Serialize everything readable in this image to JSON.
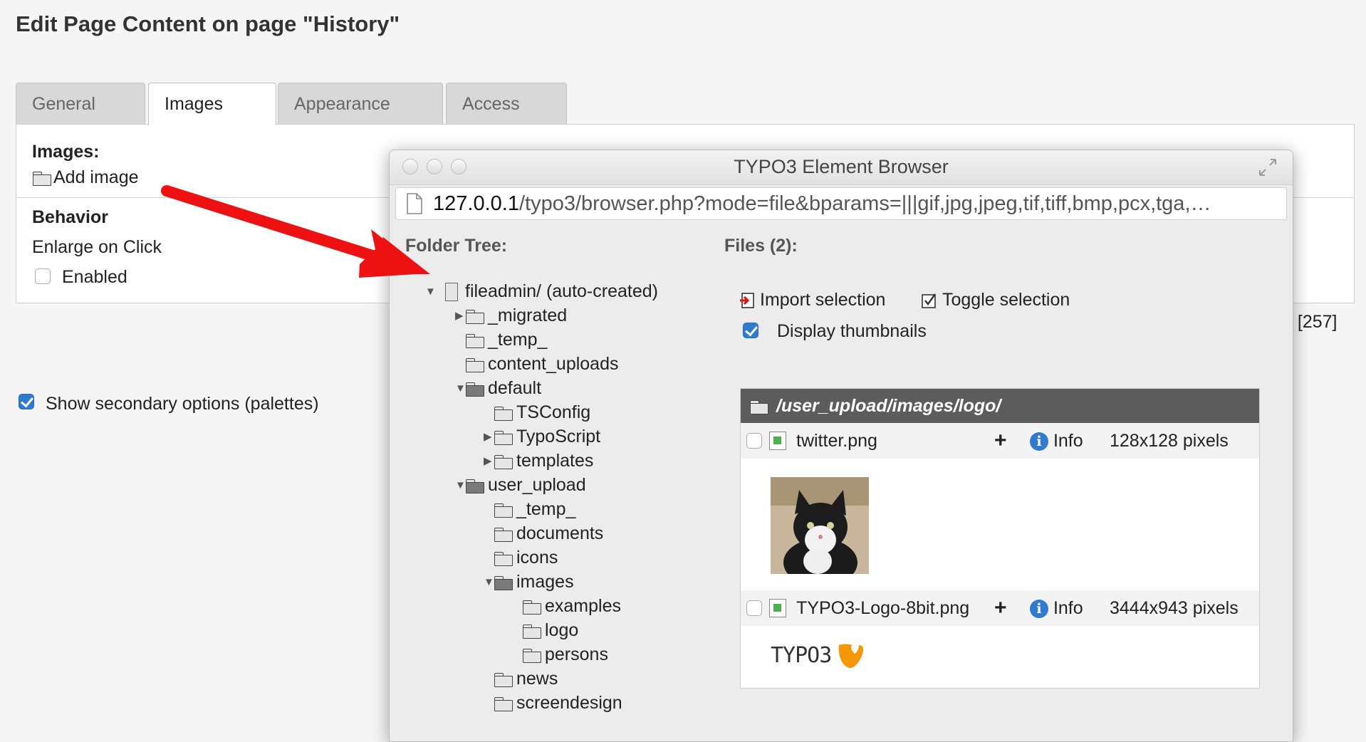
{
  "page": {
    "title": "Edit Page Content on page \"History\"",
    "tabs": [
      {
        "label": "General"
      },
      {
        "label": "Images"
      },
      {
        "label": "Appearance"
      },
      {
        "label": "Access"
      }
    ],
    "images_section": {
      "title": "Images:",
      "add_image": "Add image"
    },
    "behavior_section": {
      "title": "Behavior",
      "enlarge_label": "Enlarge on Click",
      "enabled_label": "Enabled"
    },
    "side_text": "t [257]",
    "secondary_options": "Show secondary options (palettes)"
  },
  "popup": {
    "window_title": "TYPO3 Element Browser",
    "url_host": "127.0.0.1",
    "url_path": "/typo3/browser.php?mode=file&bparams=|||gif,jpg,jpeg,tif,tiff,bmp,pcx,tga,…",
    "folder_tree_title": "Folder Tree:",
    "files_title": "Files (2):",
    "import_selection": "Import selection",
    "toggle_selection": "Toggle selection",
    "display_thumbnails": "Display thumbnails",
    "tree": [
      {
        "label": "fileadmin/ (auto-created)"
      },
      {
        "label": "_migrated"
      },
      {
        "label": "_temp_"
      },
      {
        "label": "content_uploads"
      },
      {
        "label": "default"
      },
      {
        "label": "TSConfig"
      },
      {
        "label": "TypoScript"
      },
      {
        "label": "templates"
      },
      {
        "label": "user_upload"
      },
      {
        "label": "_temp_"
      },
      {
        "label": "documents"
      },
      {
        "label": "icons"
      },
      {
        "label": "images"
      },
      {
        "label": "examples"
      },
      {
        "label": "logo"
      },
      {
        "label": "persons"
      },
      {
        "label": "news"
      },
      {
        "label": "screendesign"
      }
    ],
    "file_list": {
      "path": "/user_upload/images/logo/",
      "files": [
        {
          "name": "twitter.png",
          "add": "+",
          "info": "Info",
          "size": "128x128 pixels"
        },
        {
          "name": "TYPO3-Logo-8bit.png",
          "add": "+",
          "info": "Info",
          "size": "3444x943 pixels"
        }
      ],
      "logo_text": "TYPO3"
    }
  },
  "colors": {
    "accent": "#2f7bd0",
    "arrow": "#ee1111",
    "logo_orange": "#f49700"
  }
}
